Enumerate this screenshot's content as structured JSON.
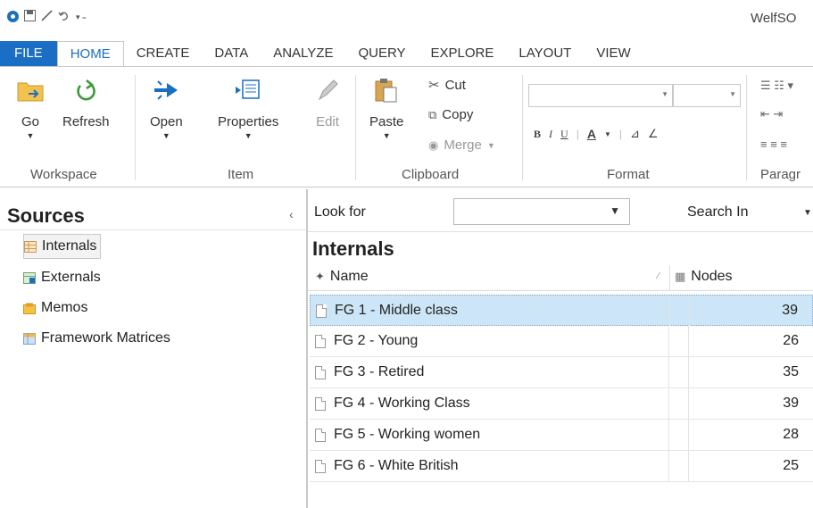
{
  "window": {
    "title": "WelfSO"
  },
  "quick_access": {
    "icons": [
      "app-icon",
      "save-icon",
      "pen-icon",
      "undo-icon",
      "customize-icon"
    ]
  },
  "tabs": [
    {
      "label": "FILE"
    },
    {
      "label": "HOME"
    },
    {
      "label": "CREATE"
    },
    {
      "label": "DATA"
    },
    {
      "label": "ANALYZE"
    },
    {
      "label": "QUERY"
    },
    {
      "label": "EXPLORE"
    },
    {
      "label": "LAYOUT"
    },
    {
      "label": "VIEW"
    }
  ],
  "ribbon": {
    "workspace": {
      "label": "Workspace",
      "go": "Go",
      "refresh": "Refresh"
    },
    "item": {
      "label": "Item",
      "open": "Open",
      "properties": "Properties",
      "edit": "Edit"
    },
    "clipboard": {
      "label": "Clipboard",
      "paste": "Paste",
      "cut": "Cut",
      "copy": "Copy",
      "merge": "Merge"
    },
    "format": {
      "label": "Format",
      "bold": "B",
      "italic": "I",
      "underline": "U",
      "font_color": "A"
    },
    "paragraph": {
      "label": "Paragr"
    }
  },
  "sources": {
    "title": "Sources",
    "items": [
      {
        "label": "Internals",
        "icon": "internals-icon"
      },
      {
        "label": "Externals",
        "icon": "externals-icon"
      },
      {
        "label": "Memos",
        "icon": "memos-icon"
      },
      {
        "label": "Framework Matrices",
        "icon": "framework-matrices-icon"
      }
    ]
  },
  "find_bar": {
    "look_for": "Look for",
    "search_in": "Search In"
  },
  "list": {
    "title": "Internals",
    "columns": {
      "name": "Name",
      "nodes": "Nodes"
    },
    "rows": [
      {
        "name": "FG 1 - Middle class",
        "nodes": "39"
      },
      {
        "name": "FG 2 - Young",
        "nodes": "26"
      },
      {
        "name": "FG 3 - Retired",
        "nodes": "35"
      },
      {
        "name": "FG 4 - Working Class",
        "nodes": "39"
      },
      {
        "name": "FG 5 - Working women",
        "nodes": "28"
      },
      {
        "name": "FG 6 - White British",
        "nodes": "25"
      }
    ]
  },
  "colors": {
    "accent": "#1a6fc4",
    "selection": "#cde6f7"
  }
}
